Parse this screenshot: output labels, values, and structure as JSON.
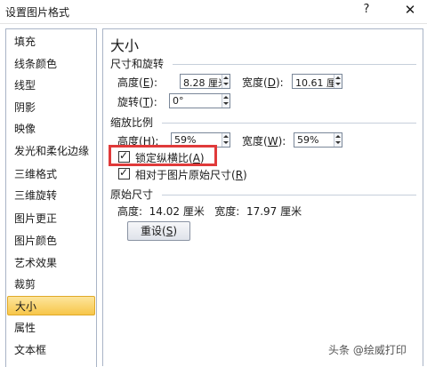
{
  "window": {
    "title": "设置图片格式",
    "help_glyph": "?",
    "close_glyph": "✕"
  },
  "nav": {
    "items": [
      {
        "label": "填充"
      },
      {
        "label": "线条颜色"
      },
      {
        "label": "线型"
      },
      {
        "label": "阴影"
      },
      {
        "label": "映像"
      },
      {
        "label": "发光和柔化边缘"
      },
      {
        "label": "三维格式"
      },
      {
        "label": "三维旋转"
      },
      {
        "label": "图片更正"
      },
      {
        "label": "图片颜色"
      },
      {
        "label": "艺术效果"
      },
      {
        "label": "裁剪"
      },
      {
        "label": "大小"
      },
      {
        "label": "属性"
      },
      {
        "label": "文本框"
      }
    ],
    "selected": "大小"
  },
  "panel": {
    "heading": "大小",
    "size_rotate": {
      "label": "尺寸和旋转",
      "height_label": "高度(",
      "height_key": "E",
      "height_value": "8.28 厘米",
      "width_label": "宽度(",
      "width_key": "D",
      "width_value": "10.61 厘",
      "rotation_label": "旋转(",
      "rotation_key": "T",
      "rotation_value": "0°",
      "label_suffix": "):"
    },
    "scale": {
      "label": "缩放比例",
      "height_label": "高度(",
      "height_key": "H",
      "height_value": "59%",
      "width_label": "宽度(",
      "width_key": "W",
      "width_value": "59%",
      "label_suffix": "):",
      "lock_aspect": {
        "label": "锁定纵横比(",
        "key": "A",
        "suffix": ")",
        "checked": true
      },
      "relative_original": {
        "label": "相对于图片原始尺寸(",
        "key": "R",
        "suffix": ")",
        "checked": true
      }
    },
    "original": {
      "label": "原始尺寸",
      "text": "高度:  14.02 厘米   宽度:  17.97 厘米"
    },
    "reset": {
      "label": "重设(",
      "key": "S",
      "suffix": ")"
    },
    "checkmark": "✓"
  },
  "watermark": "头条 @绘威打印",
  "colors": {
    "selection": "#f7c64a",
    "highlight_box": "#e03a3a",
    "border": "#a9b4c6"
  }
}
